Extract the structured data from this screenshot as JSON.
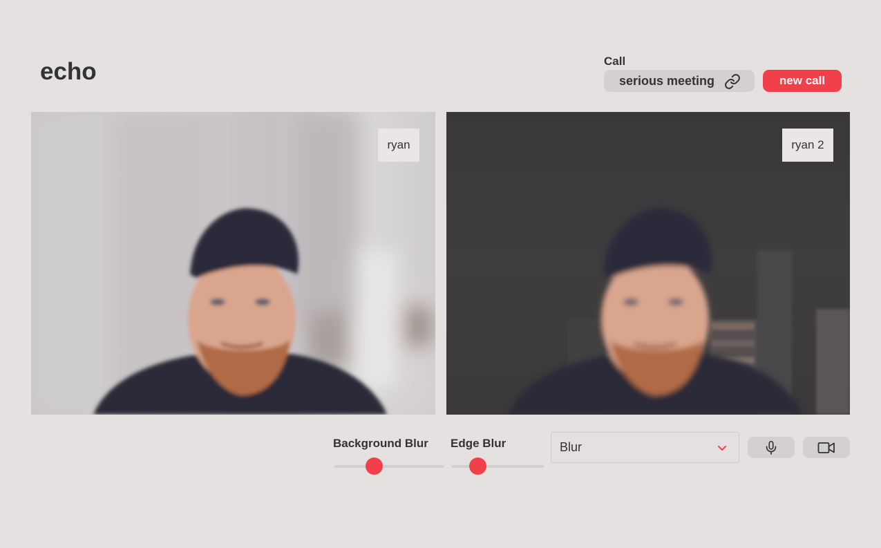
{
  "header": {
    "app_title": "echo",
    "call_label": "Call",
    "call_name": "serious meeting",
    "new_call_label": "new call"
  },
  "videos": [
    {
      "participant": "ryan",
      "background_effect": "blur"
    },
    {
      "participant": "ryan 2",
      "background_effect": "edge-blur"
    }
  ],
  "controls": {
    "background_blur": {
      "label": "Background Blur",
      "value_fraction": 0.36
    },
    "edge_blur": {
      "label": "Edge Blur",
      "value_fraction": 0.28
    },
    "effect_select": {
      "selected": "Blur",
      "options": [
        "Blur"
      ]
    },
    "mic_icon": "microphone-icon",
    "camera_icon": "video-camera-icon"
  },
  "colors": {
    "accent": "#f2404a",
    "background": "#e5e1e0",
    "button_bg": "#d4d0cf",
    "text": "#333333"
  }
}
